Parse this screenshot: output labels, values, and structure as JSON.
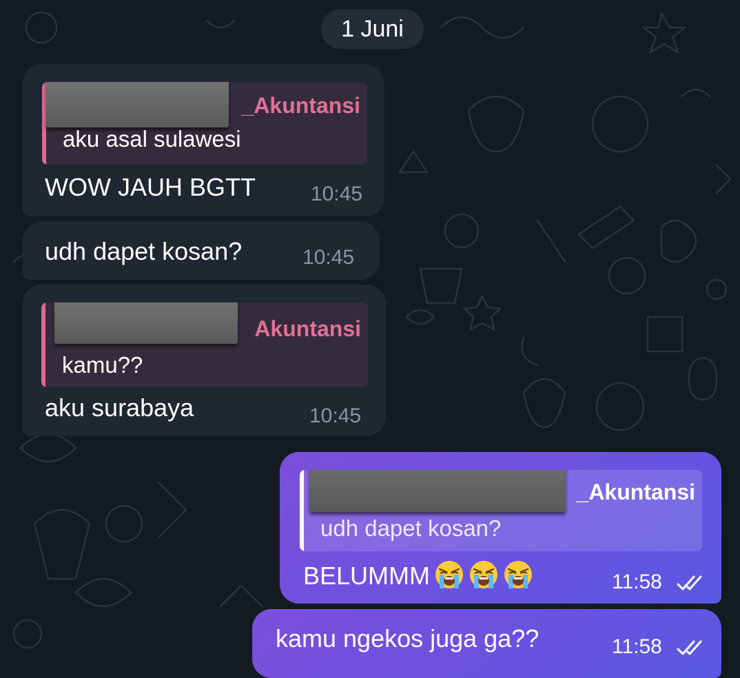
{
  "date_label": "1 Juni",
  "messages": [
    {
      "direction": "in",
      "reply": {
        "name": "_Akuntansi",
        "text": "aku asal sulawesi"
      },
      "text": "WOW JAUH BGTT",
      "time": "10:45"
    },
    {
      "direction": "in",
      "text": "udh dapet kosan?",
      "time": "10:45"
    },
    {
      "direction": "in",
      "reply": {
        "name": "Akuntansi",
        "text": "kamu??"
      },
      "text": "aku surabaya",
      "time": "10:45"
    },
    {
      "direction": "out",
      "reply": {
        "name": "_Akuntansi",
        "text": "udh dapet kosan?"
      },
      "text": "BELUMMM",
      "emojis": [
        "loudly-crying-face",
        "loudly-crying-face",
        "loudly-crying-face"
      ],
      "time": "11:58",
      "status": "read"
    },
    {
      "direction": "out",
      "text": "kamu ngekos juga ga??",
      "time": "11:58",
      "status": "read"
    }
  ],
  "colors": {
    "background": "#141a22",
    "incoming_bubble": "#1f2731",
    "outgoing_bubble": "#6a52df",
    "reply_accent": "#e26f98",
    "time_incoming": "#8b95a2"
  }
}
